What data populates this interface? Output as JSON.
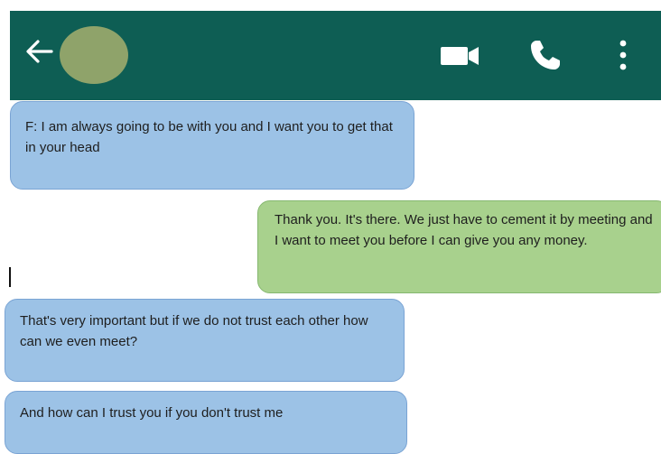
{
  "header": {
    "background_color": "#0e5e54",
    "icons": {
      "back": "arrow-left-icon",
      "avatar": "contact-avatar",
      "video": "video-camera-icon",
      "call": "phone-icon",
      "menu": "more-vertical-icon"
    }
  },
  "messages": [
    {
      "direction": "incoming",
      "text": "F: I am always going to be with you and I want you to get that in your head"
    },
    {
      "direction": "outgoing",
      "text": "Thank you. It's there. We just have to cement it by meeting and I want to meet you before I can give you any money."
    },
    {
      "direction": "incoming",
      "text": "That's very important but if we do not trust each other how can we even meet?"
    },
    {
      "direction": "incoming",
      "text": "And how can I trust you if you don't trust me"
    }
  ],
  "colors": {
    "incoming_bubble": "#9cc2e6",
    "outgoing_bubble": "#a8d18d"
  }
}
